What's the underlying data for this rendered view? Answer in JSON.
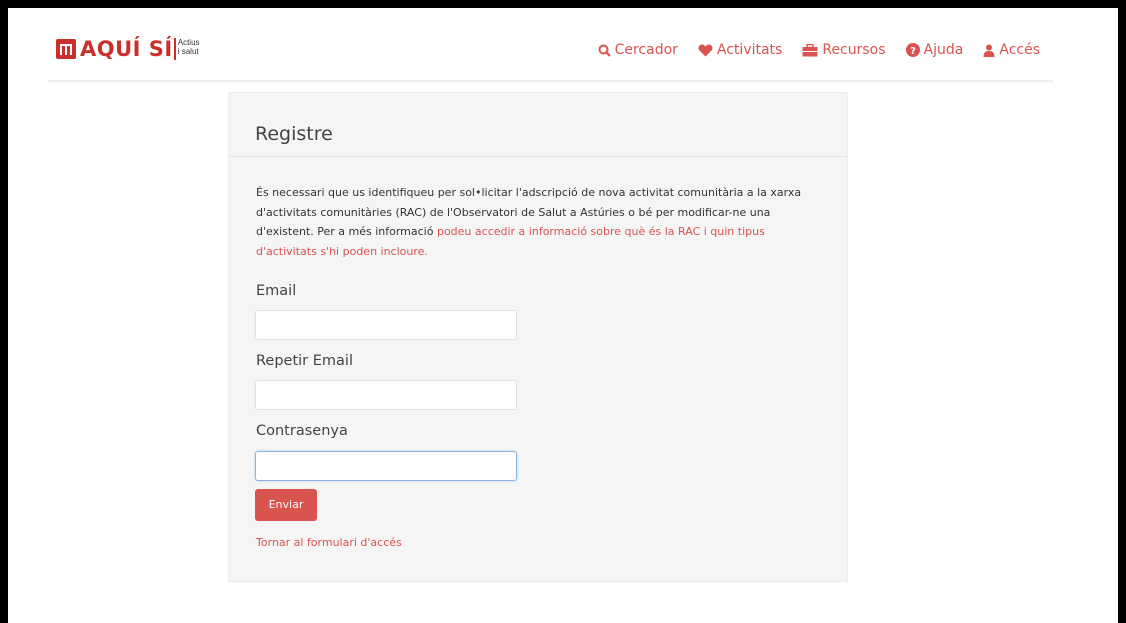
{
  "brand": {
    "name": "AQUÍ SÍ",
    "sub_line1": "Actius",
    "sub_line2": "i salut",
    "color": "#c9302c"
  },
  "nav": {
    "items": [
      {
        "label": "Cercador",
        "icon": "search-icon"
      },
      {
        "label": "Activitats",
        "icon": "heart-icon"
      },
      {
        "label": "Recursos",
        "icon": "briefcase-icon"
      },
      {
        "label": "Ajuda",
        "icon": "question-icon"
      },
      {
        "label": "Accés",
        "icon": "user-icon"
      }
    ],
    "accent": "#d9534f"
  },
  "form": {
    "title": "Registre",
    "intro_text": "És necessari que us identifiqueu per sol•licitar l'adscripció de nova activitat comunitària a la xarxa d'activitats comunitàries (RAC) de l'Observatori de Salut a Astúries o bé per modificar-ne una d'existent. Per a més informació ",
    "intro_link": "podeu accedir a informació sobre què és la RAC i quin tipus d'activitats s'hi poden incloure.",
    "fields": [
      {
        "label": "Email",
        "value": ""
      },
      {
        "label": "Repetir Email",
        "value": ""
      },
      {
        "label": "Contrasenya",
        "value": ""
      }
    ],
    "submit_label": "Enviar",
    "back_link": "Tornar al formulari d'accés"
  }
}
